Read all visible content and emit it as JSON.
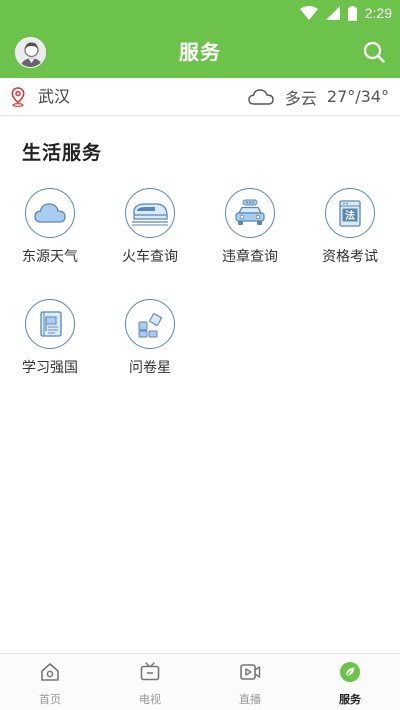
{
  "status_bar": {
    "time": "2:29"
  },
  "header": {
    "title": "服务"
  },
  "info_bar": {
    "city": "武汉",
    "weather": "多云",
    "temperature": "27°/34°"
  },
  "section": {
    "title": "生活服务",
    "items": [
      {
        "label": "东源天气",
        "icon": "cloud-icon"
      },
      {
        "label": "火车查询",
        "icon": "train-icon"
      },
      {
        "label": "违章查询",
        "icon": "car-icon"
      },
      {
        "label": "资格考试",
        "icon": "law-book-icon"
      },
      {
        "label": "学习强国",
        "icon": "flag-book-icon"
      },
      {
        "label": "问卷星",
        "icon": "questionnaire-icon"
      }
    ]
  },
  "tab_bar": {
    "tabs": [
      {
        "label": "首页",
        "icon": "home-icon"
      },
      {
        "label": "电视",
        "icon": "tv-icon"
      },
      {
        "label": "直播",
        "icon": "live-video-icon"
      },
      {
        "label": "服务",
        "icon": "service-leaf-icon"
      }
    ],
    "active_tab": "服务"
  },
  "colors": {
    "brand_green": "#6cc24a",
    "icon_blue": "#5a86b5",
    "icon_fill": "#a9cdf0"
  }
}
